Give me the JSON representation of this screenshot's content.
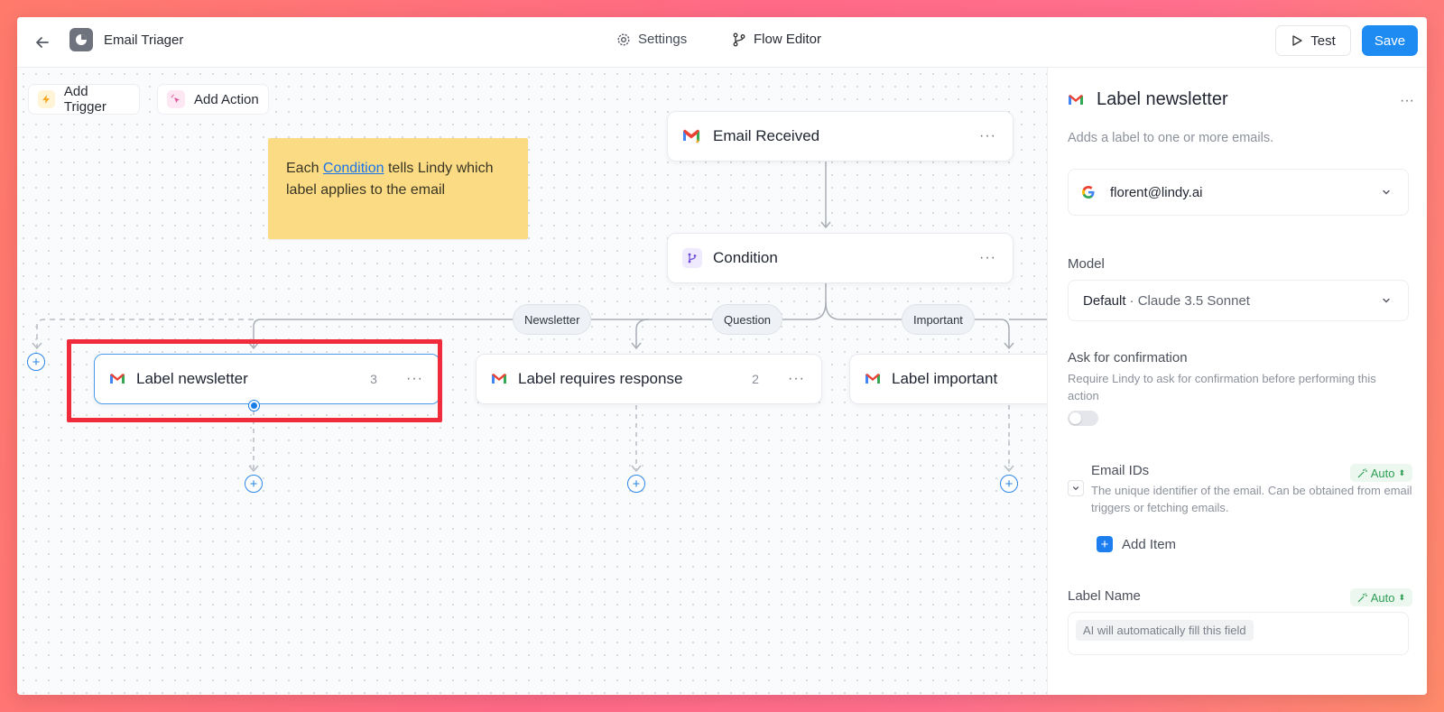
{
  "header": {
    "app_title": "Email Triager",
    "settings_label": "Settings",
    "flow_editor_label": "Flow Editor",
    "test_label": "Test",
    "save_label": "Save"
  },
  "toolbar": {
    "add_trigger_label": "Add Trigger",
    "add_action_label": "Add Action"
  },
  "note": {
    "prefix": "Each ",
    "link": "Condition",
    "suffix": " tells Lindy which label applies to the email"
  },
  "nodes": {
    "email_received": {
      "label": "Email Received"
    },
    "condition": {
      "label": "Condition"
    },
    "label_newsletter": {
      "label": "Label newsletter",
      "count": "3"
    },
    "label_requires_response": {
      "label": "Label requires response",
      "count": "2"
    },
    "label_important": {
      "label": "Label important"
    }
  },
  "branches": {
    "newsletter": "Newsletter",
    "question": "Question",
    "important": "Important"
  },
  "panel": {
    "title": "Label newsletter",
    "description": "Adds a label to one or more emails.",
    "account": "florent@lindy.ai",
    "model_label": "Model",
    "model_value": "Default",
    "model_sub": "· Claude 3.5 Sonnet",
    "confirm_label": "Ask for confirmation",
    "confirm_desc": "Require Lindy to ask for confirmation before performing this action",
    "email_ids_label": "Email IDs",
    "email_ids_desc": "The unique identifier of the email. Can be obtained from email triggers or fetching emails.",
    "auto_label": "Auto",
    "add_item_label": "Add Item",
    "label_name_label": "Label Name",
    "label_name_placeholder": "AI will automatically fill this field"
  },
  "colors": {
    "accent": "#1d8bf2",
    "highlight": "#ef2b3c",
    "note": "#fbdc84"
  }
}
